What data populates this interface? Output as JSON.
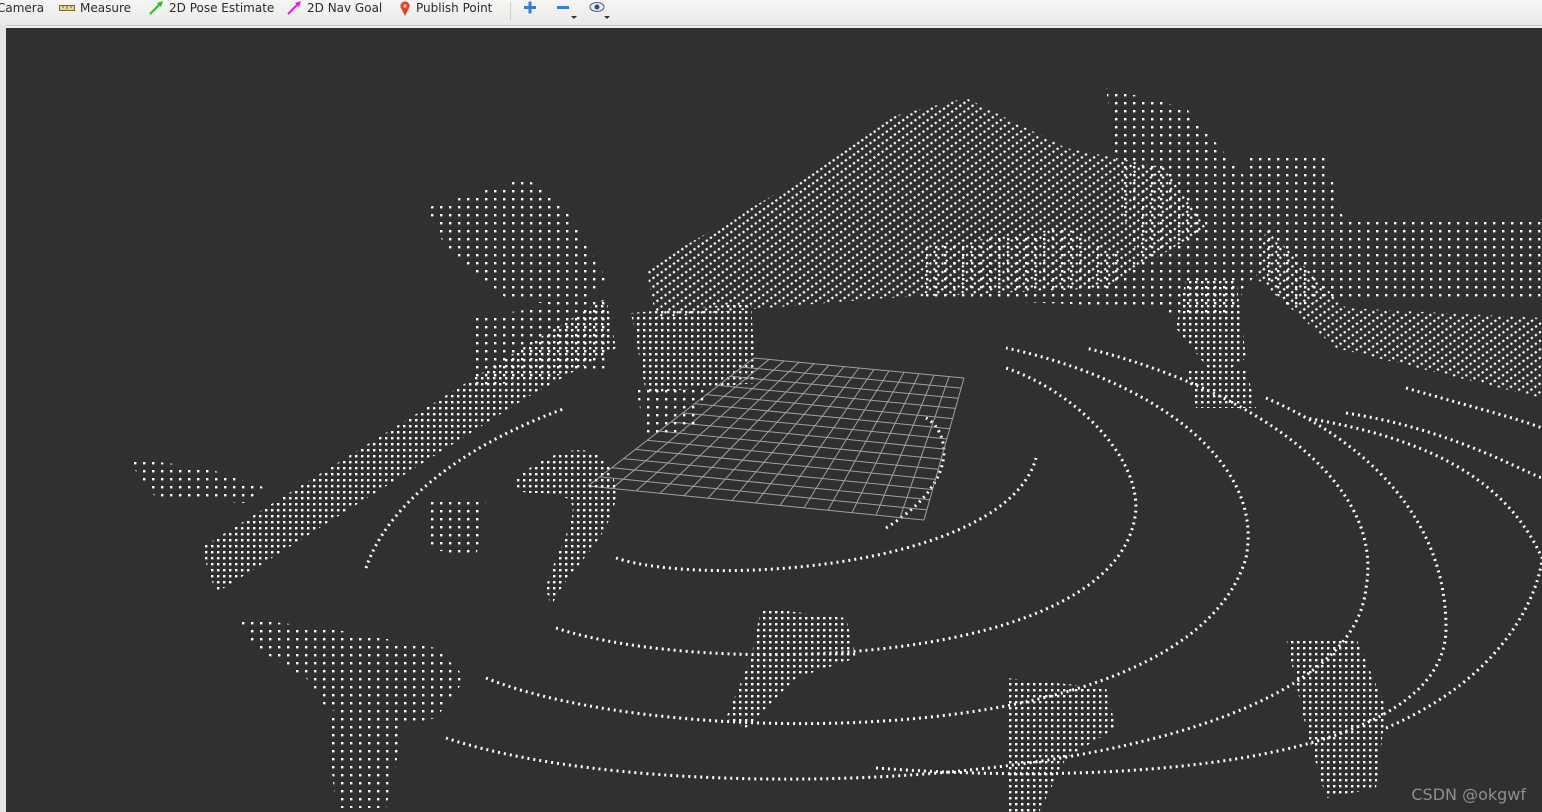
{
  "toolbar": {
    "tools": [
      {
        "label": "Camera",
        "icon": "camera-icon"
      },
      {
        "label": "Measure",
        "icon": "ruler-icon"
      },
      {
        "label": "2D Pose Estimate",
        "icon": "green-arrow-icon",
        "color": "#22c322"
      },
      {
        "label": "2D Nav Goal",
        "icon": "magenta-arrow-icon",
        "color": "#e020e0"
      },
      {
        "label": "Publish Point",
        "icon": "map-pin-icon",
        "color": "#d9472b"
      }
    ],
    "zoom_in_icon": "plus-icon",
    "zoom_out_icon": "minus-icon",
    "view_icon": "eye-icon"
  },
  "viewport": {
    "background": "#303030",
    "point_color": "#ffffff",
    "grid_color": "#a0a0a0"
  },
  "watermark": "CSDN @okgwf"
}
